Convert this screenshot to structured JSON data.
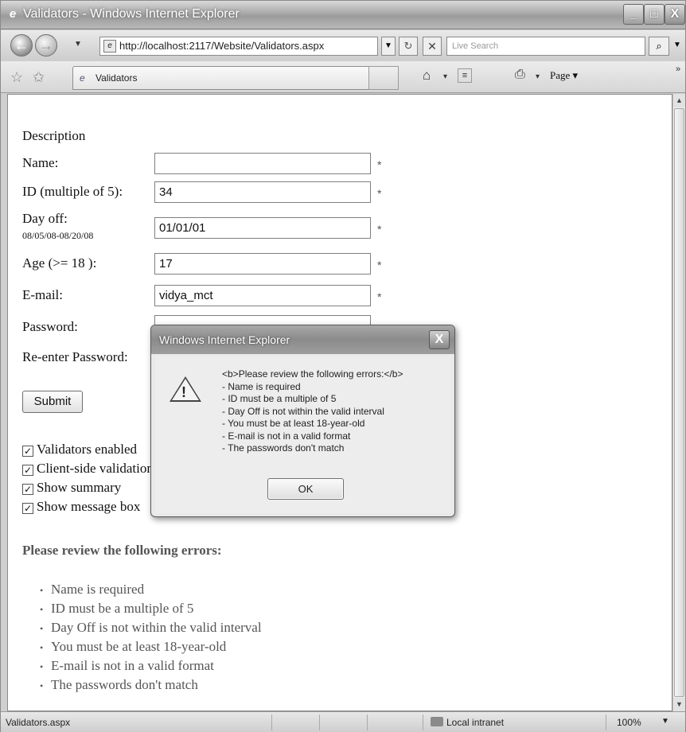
{
  "window": {
    "title": "Validators - Windows Internet Explorer",
    "minimize": "_",
    "maximize": "□",
    "close": "X"
  },
  "nav": {
    "back": "←",
    "forward": "→",
    "dropdown": "▼",
    "address": "http://localhost:2117/Website/Validators.aspx",
    "refresh": "↻",
    "stop": "✕",
    "search_placeholder": "Live Search",
    "search_go": "⌕"
  },
  "favbar": {
    "tab_label": "Validators",
    "page_menu": "Page ▾",
    "more": "»"
  },
  "form": {
    "description": "Description",
    "name_label": "Name:",
    "name_value": "",
    "id_label": "ID (multiple of 5):",
    "id_value": "34",
    "dayoff_label": "Day off:",
    "dayoff_range": "08/05/08-08/20/08",
    "dayoff_value": "01/01/01",
    "age_label": "Age (>= 18 ):",
    "age_value": "17",
    "email_label": "E-mail:",
    "email_value": "vidya_mct",
    "password_label": "Password:",
    "reenter_label": "Re-enter Password:",
    "required_marker": "*",
    "submit": "Submit"
  },
  "checkboxes": [
    {
      "label": "Validators enabled",
      "checked": true
    },
    {
      "label": "Client-side validation",
      "checked": true
    },
    {
      "label": "Show summary",
      "checked": true
    },
    {
      "label": "Show message box",
      "checked": true
    }
  ],
  "summary": {
    "heading": "Please review the following errors:",
    "errors": [
      "Name is required",
      "ID must be a multiple of 5",
      "Day Off is not within the valid interval",
      "You must be at least 18-year-old",
      "E-mail is not in a valid format",
      "The passwords don't match"
    ]
  },
  "dialog": {
    "title": "Windows Internet Explorer",
    "close": "X",
    "lines": [
      "<b>Please review the following errors:</b>",
      "- Name is required",
      "- ID must be a multiple of 5",
      "- Day Off is not within the valid interval",
      "- You must be at least 18-year-old",
      "- E-mail is not in a valid format",
      "- The passwords don't match"
    ],
    "ok": "OK"
  },
  "statusbar": {
    "text": "Validators.aspx",
    "zone": "Local intranet",
    "zoom": "100%",
    "zoom_dropdown": "▼"
  }
}
